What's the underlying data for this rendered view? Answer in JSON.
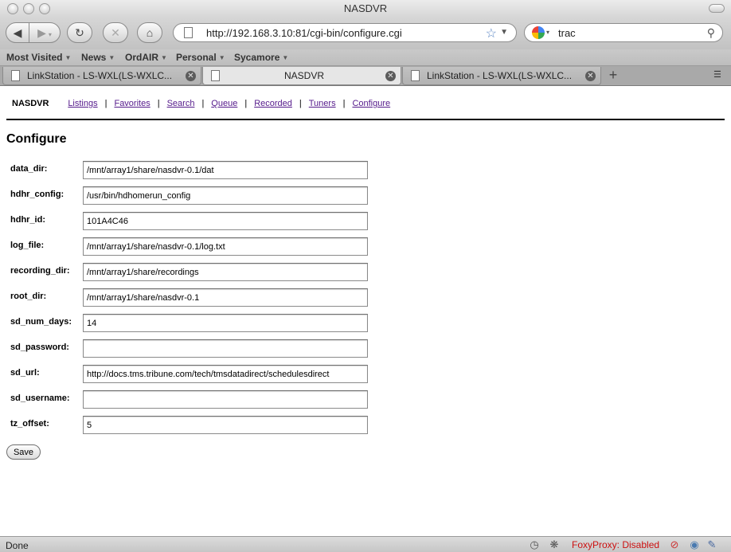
{
  "window": {
    "title": "NASDVR"
  },
  "toolbar": {
    "url": "http://192.168.3.10:81/cgi-bin/configure.cgi",
    "search_value": "trac"
  },
  "bookmarks": [
    {
      "label": "Most Visited"
    },
    {
      "label": "News"
    },
    {
      "label": "OrdAIR"
    },
    {
      "label": "Personal"
    },
    {
      "label": "Sycamore"
    }
  ],
  "tabs": [
    {
      "label": "LinkStation - LS-WXL(LS-WXLC..."
    },
    {
      "label": "NASDVR"
    },
    {
      "label": "LinkStation - LS-WXL(LS-WXLC..."
    }
  ],
  "sitenav": {
    "brand": "NASDVR",
    "links": [
      "Listings",
      "Favorites",
      "Search",
      "Queue",
      "Recorded",
      "Tuners",
      "Configure"
    ],
    "separator": "|"
  },
  "page": {
    "heading": "Configure"
  },
  "fields": [
    {
      "label": "data_dir:",
      "value": "/mnt/array1/share/nasdvr-0.1/dat"
    },
    {
      "label": "hdhr_config:",
      "value": "/usr/bin/hdhomerun_config"
    },
    {
      "label": "hdhr_id:",
      "value": "101A4C46"
    },
    {
      "label": "log_file:",
      "value": "/mnt/array1/share/nasdvr-0.1/log.txt"
    },
    {
      "label": "recording_dir:",
      "value": "/mnt/array1/share/recordings"
    },
    {
      "label": "root_dir:",
      "value": "/mnt/array1/share/nasdvr-0.1"
    },
    {
      "label": "sd_num_days:",
      "value": "14"
    },
    {
      "label": "sd_password:",
      "value": ""
    },
    {
      "label": "sd_url:",
      "value": "http://docs.tms.tribune.com/tech/tmsdatadirect/schedulesdirect"
    },
    {
      "label": "sd_username:",
      "value": ""
    },
    {
      "label": "tz_offset:",
      "value": "5"
    }
  ],
  "form": {
    "save_label": "Save"
  },
  "status": {
    "text": "Done",
    "foxyproxy": "FoxyProxy: Disabled"
  },
  "colors": {
    "visited_link": "#551a8b",
    "foxyproxy_red": "#cc1111"
  }
}
